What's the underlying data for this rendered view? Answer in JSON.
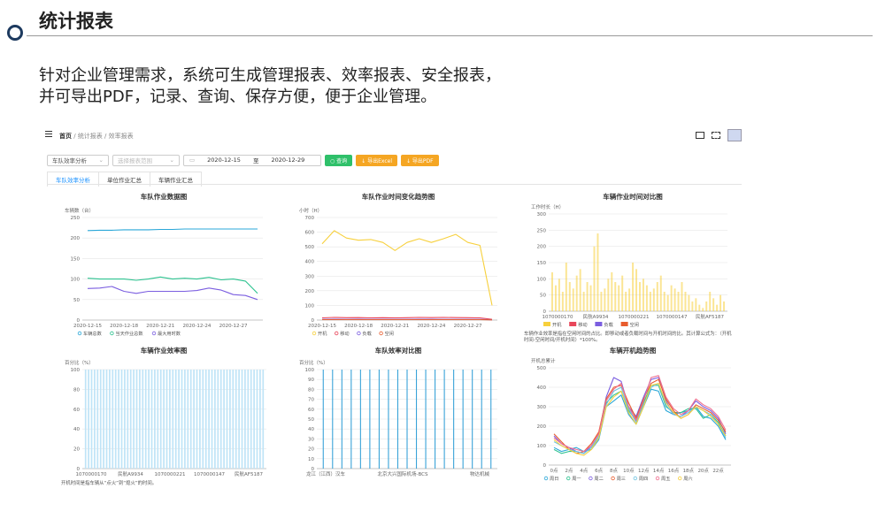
{
  "slide": {
    "title": "统计报表",
    "intro_line1": "针对企业管理需求，系统可生成管理报表、效率报表、安全报表，",
    "intro_line2": "并可导出PDF，记录、查询、保存方便，便于企业管理。"
  },
  "app": {
    "breadcrumb": {
      "home": "首页",
      "sep1": " / ",
      "reports": "统计报表",
      "sep2": " / ",
      "current": "效率报表"
    },
    "filters": {
      "report_type": "车队效率分析",
      "scope_placeholder": "选择报表范围",
      "date_start": "2020-12-15",
      "date_to": "至",
      "date_end": "2020-12-29",
      "query_btn": "○ 查询",
      "excel_btn": "↓ 导出Excel",
      "pdf_btn": "↓ 导出PDF"
    },
    "tabs": [
      "车队效率分析",
      "单位作业汇总",
      "车辆作业汇总"
    ],
    "active_tab": 0,
    "colors": {
      "accent": "#1890ff",
      "green": "#2fc06a",
      "orange": "#f5a623"
    }
  },
  "chart_data": [
    {
      "type": "line",
      "title": "车队作业数据图",
      "ylabel": "车辆数（台）",
      "ylim": [
        0,
        250
      ],
      "yticks": [
        0,
        50,
        100,
        150,
        200,
        250
      ],
      "x": [
        "2020-12-15",
        "2020-12-16",
        "2020-12-17",
        "2020-12-18",
        "2020-12-19",
        "2020-12-20",
        "2020-12-21",
        "2020-12-22",
        "2020-12-23",
        "2020-12-24",
        "2020-12-25",
        "2020-12-26",
        "2020-12-27",
        "2020-12-28",
        "2020-12-29"
      ],
      "xtick_labels": [
        "2020-12-15",
        "2020-12-18",
        "2020-12-21",
        "2020-12-24",
        "2020-12-27"
      ],
      "series": [
        {
          "name": "车辆总数",
          "color": "#2aa7d8",
          "values": [
            218,
            219,
            219,
            220,
            220,
            220,
            221,
            221,
            222,
            222,
            222,
            222,
            222,
            222,
            222
          ]
        },
        {
          "name": "当天作业总数",
          "color": "#2cc28f",
          "values": [
            102,
            100,
            100,
            100,
            97,
            100,
            105,
            100,
            102,
            100,
            104,
            98,
            100,
            95,
            65
          ]
        },
        {
          "name": "最大用时数",
          "color": "#7b5ee0",
          "values": [
            77,
            78,
            82,
            70,
            65,
            70,
            70,
            70,
            70,
            72,
            78,
            73,
            62,
            60,
            50
          ]
        }
      ]
    },
    {
      "type": "line",
      "title": "车队作业时间变化趋势图",
      "ylabel": "小时（H）",
      "ylim": [
        0,
        700
      ],
      "yticks": [
        0,
        100,
        200,
        300,
        400,
        500,
        600,
        700
      ],
      "x": [
        "2020-12-15",
        "2020-12-16",
        "2020-12-17",
        "2020-12-18",
        "2020-12-19",
        "2020-12-20",
        "2020-12-21",
        "2020-12-22",
        "2020-12-23",
        "2020-12-24",
        "2020-12-25",
        "2020-12-26",
        "2020-12-27",
        "2020-12-28",
        "2020-12-29"
      ],
      "xtick_labels": [
        "2020-12-15",
        "2020-12-18",
        "2020-12-21",
        "2020-12-24",
        "2020-12-27"
      ],
      "series": [
        {
          "name": "开机",
          "color": "#f7d03c",
          "values": [
            520,
            610,
            560,
            545,
            550,
            530,
            475,
            530,
            555,
            530,
            555,
            585,
            530,
            510,
            100
          ]
        },
        {
          "name": "移动",
          "color": "#e8465a",
          "values": [
            15,
            18,
            16,
            17,
            15,
            16,
            15,
            16,
            18,
            17,
            18,
            17,
            16,
            15,
            5
          ]
        },
        {
          "name": "负载",
          "color": "#7b5ee0",
          "values": [
            5,
            6,
            5,
            6,
            5,
            5,
            5,
            5,
            6,
            6,
            5,
            5,
            5,
            5,
            2
          ]
        },
        {
          "name": "空闲",
          "color": "#e85c2d",
          "values": [
            3,
            3,
            3,
            3,
            3,
            3,
            3,
            3,
            3,
            3,
            3,
            3,
            3,
            3,
            1
          ]
        }
      ]
    },
    {
      "type": "bar",
      "title": "车辆作业时间对比图",
      "ylabel": "工作时长（H）",
      "ylim": [
        0,
        300
      ],
      "yticks": [
        0,
        50,
        100,
        150,
        200,
        250,
        300
      ],
      "xtick_labels": [
        "1070000170",
        "民航A9934",
        "1070000221",
        "1070000147",
        "民航AF5187"
      ],
      "values": [
        120,
        80,
        100,
        60,
        150,
        90,
        70,
        110,
        130,
        60,
        90,
        80,
        200,
        240,
        60,
        70,
        100,
        120,
        90,
        80,
        110,
        60,
        70,
        150,
        130,
        90,
        100,
        80,
        60,
        70,
        90,
        110,
        60,
        50,
        80,
        70,
        60,
        90,
        60,
        50,
        30,
        40,
        20,
        10,
        30,
        60,
        40,
        20,
        50,
        30
      ],
      "series": [
        {
          "name": "开机",
          "color": "#f7d03c"
        },
        {
          "name": "移动",
          "color": "#e8465a"
        },
        {
          "name": "负载",
          "color": "#7b5ee0"
        },
        {
          "name": "空闲",
          "color": "#e85c2d"
        }
      ],
      "note_line1": "车辆作业效率是指在空闲时间的占比。即移动或者负载时间与开机时间的比。其计算公式为：（开机",
      "note_line2": "时间-空闲时间/开机时间）*100%。"
    },
    {
      "type": "bar",
      "title": "车辆作业效率图",
      "ylabel": "百分比（%）",
      "ylim": [
        0,
        100
      ],
      "yticks": [
        0,
        20,
        40,
        60,
        80,
        100
      ],
      "xtick_labels": [
        "1070000170",
        "民航A9934",
        "1070000221",
        "1070000147",
        "民航AF5187"
      ],
      "values": [
        100,
        100,
        100,
        100,
        100,
        100,
        100,
        100,
        100,
        100,
        100,
        100,
        100,
        100,
        100,
        100,
        100,
        100,
        100,
        100,
        100,
        100,
        100,
        100,
        100,
        100,
        100,
        100,
        100,
        100,
        100,
        100,
        100,
        100,
        100,
        100,
        100,
        100,
        100,
        100,
        100,
        100,
        100,
        100,
        100,
        100,
        100,
        100,
        100,
        100,
        100,
        100,
        100,
        100,
        100,
        100,
        100,
        100,
        100,
        100
      ],
      "color": "#bfe4f7",
      "note": "开机时间是指车辆从“点火”到“熄火”的时间。"
    },
    {
      "type": "bar",
      "title": "车队效率对比图",
      "ylabel": "百分比（%）",
      "ylim": [
        0,
        100
      ],
      "yticks": [
        0,
        10,
        20,
        30,
        40,
        50,
        60,
        70,
        80,
        90,
        100
      ],
      "xtick_labels": [
        "龙江（江西）汉车",
        "北京大兴国际机场-BCS",
        "物达机械"
      ],
      "values": [
        100,
        100,
        100,
        100,
        100,
        100,
        100,
        100,
        100,
        100,
        100,
        100,
        100,
        100,
        100,
        100,
        100,
        100,
        100
      ],
      "color": "#3aa3d8"
    },
    {
      "type": "line",
      "title": "车辆开机趋势图",
      "ylabel": "开机总累计",
      "ylim": [
        0,
        500
      ],
      "yticks": [
        0,
        100,
        200,
        300,
        400,
        500
      ],
      "x": [
        "0点",
        "1点",
        "2点",
        "3点",
        "4点",
        "5点",
        "6点",
        "7点",
        "8点",
        "9点",
        "10点",
        "11点",
        "12点",
        "13点",
        "14点",
        "15点",
        "16点",
        "17点",
        "18点",
        "19点",
        "20点",
        "21点",
        "22点",
        "23点"
      ],
      "xtick_labels": [
        "0点",
        "2点",
        "4点",
        "6点",
        "8点",
        "10点",
        "12点",
        "14点",
        "16点",
        "18点",
        "20点",
        "22点"
      ],
      "series": [
        {
          "name": "周日",
          "color": "#2aa7d8",
          "values": [
            90,
            70,
            80,
            90,
            70,
            80,
            130,
            300,
            330,
            360,
            260,
            210,
            300,
            390,
            380,
            280,
            260,
            270,
            280,
            300,
            250,
            240,
            200,
            130
          ]
        },
        {
          "name": "周一",
          "color": "#2cc28f",
          "values": [
            80,
            60,
            70,
            70,
            60,
            90,
            140,
            320,
            360,
            380,
            280,
            230,
            320,
            410,
            410,
            300,
            270,
            270,
            290,
            290,
            240,
            260,
            220,
            150
          ]
        },
        {
          "name": "周二",
          "color": "#7b5ee0",
          "values": [
            150,
            110,
            90,
            70,
            60,
            100,
            160,
            350,
            450,
            430,
            300,
            250,
            350,
            440,
            450,
            330,
            260,
            250,
            280,
            330,
            300,
            280,
            240,
            160
          ]
        },
        {
          "name": "周三",
          "color": "#e85c2d",
          "values": [
            160,
            120,
            80,
            60,
            70,
            110,
            170,
            340,
            400,
            410,
            320,
            240,
            340,
            420,
            440,
            340,
            280,
            240,
            260,
            310,
            290,
            270,
            230,
            170
          ]
        },
        {
          "name": "周四",
          "color": "#6fc3e0",
          "values": [
            120,
            100,
            80,
            70,
            60,
            90,
            150,
            310,
            380,
            400,
            290,
            220,
            310,
            400,
            420,
            310,
            260,
            250,
            270,
            300,
            280,
            260,
            210,
            140
          ]
        },
        {
          "name": "周五",
          "color": "#ee6f8f",
          "values": [
            140,
            110,
            90,
            80,
            70,
            100,
            160,
            330,
            390,
            420,
            300,
            230,
            330,
            450,
            460,
            350,
            290,
            260,
            280,
            340,
            310,
            290,
            250,
            180
          ]
        },
        {
          "name": "周六",
          "color": "#f7d03c",
          "values": [
            130,
            100,
            80,
            60,
            50,
            80,
            140,
            300,
            350,
            380,
            270,
            210,
            300,
            410,
            420,
            320,
            270,
            240,
            260,
            300,
            280,
            250,
            210,
            150
          ]
        }
      ]
    }
  ]
}
